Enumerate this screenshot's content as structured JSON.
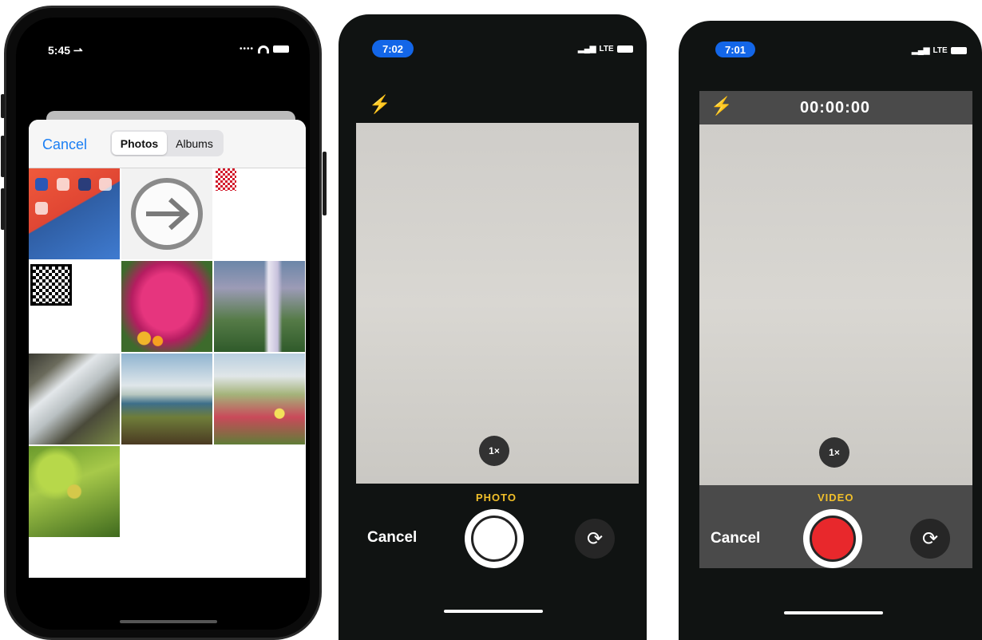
{
  "phone1": {
    "status_time": "5:45 ⇀",
    "cancel_label": "Cancel",
    "segments": [
      "Photos",
      "Albums"
    ],
    "active_segment": "Photos",
    "thumbnails": [
      {
        "kind": "home-screen"
      },
      {
        "kind": "arrow-icon"
      },
      {
        "kind": "qr-small"
      },
      {
        "kind": "qr-code"
      },
      {
        "kind": "flowers"
      },
      {
        "kind": "waterfall"
      },
      {
        "kind": "waterfall"
      },
      {
        "kind": "waterfall"
      },
      {
        "kind": "dunes"
      },
      {
        "kind": "leaves"
      }
    ]
  },
  "phone2": {
    "status_time": "7:02",
    "network": "LTE",
    "zoom_label": "1×",
    "mode_label": "PHOTO",
    "cancel_label": "Cancel",
    "flash_icon": "bolt-icon",
    "flip_icon": "camera-flip-icon"
  },
  "phone3": {
    "status_time": "7:01",
    "network": "LTE",
    "timer": "00:00:00",
    "zoom_label": "1×",
    "mode_label": "VIDEO",
    "cancel_label": "Cancel",
    "flash_icon": "bolt-icon",
    "flip_icon": "camera-flip-icon",
    "record_color": "#e8282c"
  }
}
